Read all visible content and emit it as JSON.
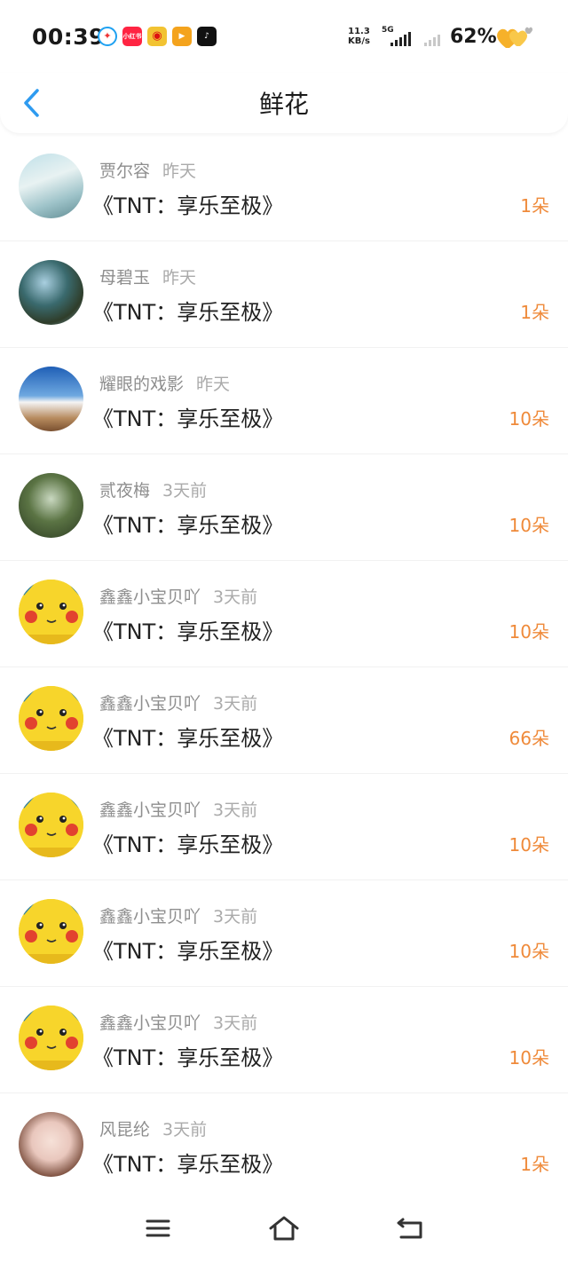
{
  "status_bar": {
    "time": "00:39",
    "net_speed_value": "11.3",
    "net_speed_unit": "KB/s",
    "network_type": "5G",
    "battery": "62%",
    "app_icons": [
      "qq-browser-icon",
      "xiaohongshu-icon",
      "weibo-icon",
      "video-app-icon",
      "tiktok-icon"
    ],
    "xiaohongshu_text": "小红书"
  },
  "header": {
    "title": "鲜花",
    "back_icon": "chevron-left-icon",
    "accent_color": "#2e9bf0"
  },
  "count_color": "#ef8a3a",
  "items": [
    {
      "name": "贾尔容",
      "time": "昨天",
      "book": "《TNT：享乐至极》",
      "count": "1朵",
      "avatar": "girl-photo"
    },
    {
      "name": "母碧玉",
      "time": "昨天",
      "book": "《TNT：享乐至极》",
      "count": "1朵",
      "avatar": "tree-photo"
    },
    {
      "name": "耀眼的戏影",
      "time": "昨天",
      "book": "《TNT：享乐至极》",
      "count": "10朵",
      "avatar": "wave-photo"
    },
    {
      "name": "贰夜梅",
      "time": "3天前",
      "book": "《TNT：享乐至极》",
      "count": "10朵",
      "avatar": "forest-photo"
    },
    {
      "name": "鑫鑫小宝贝吖",
      "time": "3天前",
      "book": "《TNT：享乐至极》",
      "count": "10朵",
      "avatar": "pikachu"
    },
    {
      "name": "鑫鑫小宝贝吖",
      "time": "3天前",
      "book": "《TNT：享乐至极》",
      "count": "66朵",
      "avatar": "pikachu"
    },
    {
      "name": "鑫鑫小宝贝吖",
      "time": "3天前",
      "book": "《TNT：享乐至极》",
      "count": "10朵",
      "avatar": "pikachu"
    },
    {
      "name": "鑫鑫小宝贝吖",
      "time": "3天前",
      "book": "《TNT：享乐至极》",
      "count": "10朵",
      "avatar": "pikachu"
    },
    {
      "name": "鑫鑫小宝贝吖",
      "time": "3天前",
      "book": "《TNT：享乐至极》",
      "count": "10朵",
      "avatar": "pikachu"
    },
    {
      "name": "风昆纶",
      "time": "3天前",
      "book": "《TNT：享乐至极》",
      "count": "1朵",
      "avatar": "doll-photo"
    }
  ],
  "nav": {
    "menu_icon": "menu-icon",
    "home_icon": "home-icon",
    "back_icon": "back-arrow-icon"
  }
}
